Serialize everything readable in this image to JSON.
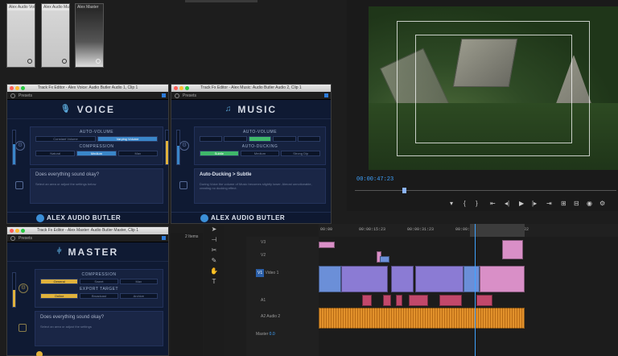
{
  "thumbnails": [
    {
      "label": "Alex Audio Voice"
    },
    {
      "label": "Alex Audio Music"
    },
    {
      "label": "Alex Master"
    }
  ],
  "voice_window": {
    "title": "Track Fx Editor - Alex Voice: Audio Butler Audio 1, Clip 1",
    "preset": "Presets",
    "header": "VOICE",
    "auto_volume_label": "AUTO-VOLUME",
    "auto_volume_options": [
      "Constant Volume",
      "Varying Volume"
    ],
    "auto_volume_selected": 1,
    "compression_label": "COMPRESSION",
    "compression_options": [
      "Natural",
      "Medium",
      "Max"
    ],
    "compression_selected": 1,
    "question": "Does everything sound okay?",
    "sub": "Select an area or adjust the settings below",
    "brand": "ALEX AUDIO BUTLER"
  },
  "music_window": {
    "title": "Track Fx Editor - Alex Music: Audio Butler Audio 2, Clip 1",
    "preset": "Presets",
    "header": "MUSIC",
    "auto_volume_label": "AUTO-VOLUME",
    "auto_volume_options": [
      "",
      "",
      " ",
      "",
      ""
    ],
    "ducking_label": "AUTO-DUCKING",
    "ducking_options": [
      "Subtle",
      "Medium",
      "Strong Dip"
    ],
    "ducking_selected": 0,
    "info_title": "Auto-Ducking > Subtle",
    "info_text": "During Voice the volume of Music becomes slightly lower. Almost unnoticeable, creating no ducking effect.",
    "brand": "ALEX AUDIO BUTLER"
  },
  "master_window": {
    "title": "Track Fx Editor - Alex Master: Audio Butler Master, Clip 1",
    "preset": "Presets",
    "side_label": "2 Items",
    "header": "MASTER",
    "compression_label": "COMPRESSION",
    "compression_options": [
      "General",
      "Sweet",
      "Max"
    ],
    "compression_selected": 0,
    "export_label": "EXPORT TARGET",
    "export_options": [
      "Online",
      "Broadcast",
      "Archive"
    ],
    "export_selected": 0,
    "question": "Does everything sound okay?",
    "sub": "Select an area or adjust the settings"
  },
  "monitor": {
    "timecode": "00:00:47:23",
    "playhead_progress": 0.18
  },
  "timeline": {
    "ruler_ticks": [
      "00:00",
      "00:00:15:23",
      "00:00:31:23",
      "00:00:47:23",
      "00:01:03:22"
    ],
    "tracks": [
      {
        "name": "V3"
      },
      {
        "name": "V2"
      },
      {
        "name": "V1",
        "label": "Video 1"
      },
      {
        "name": "A1"
      },
      {
        "name": "A2",
        "label": "Audio 2"
      },
      {
        "name": "Master",
        "value": "0.0"
      }
    ]
  },
  "colors": {
    "accent": "#3a86c9",
    "green": "#3fb86a",
    "yellow": "#e0b23c",
    "video_clip": "#8b7bd4",
    "audio_clip": "#e2912b"
  }
}
